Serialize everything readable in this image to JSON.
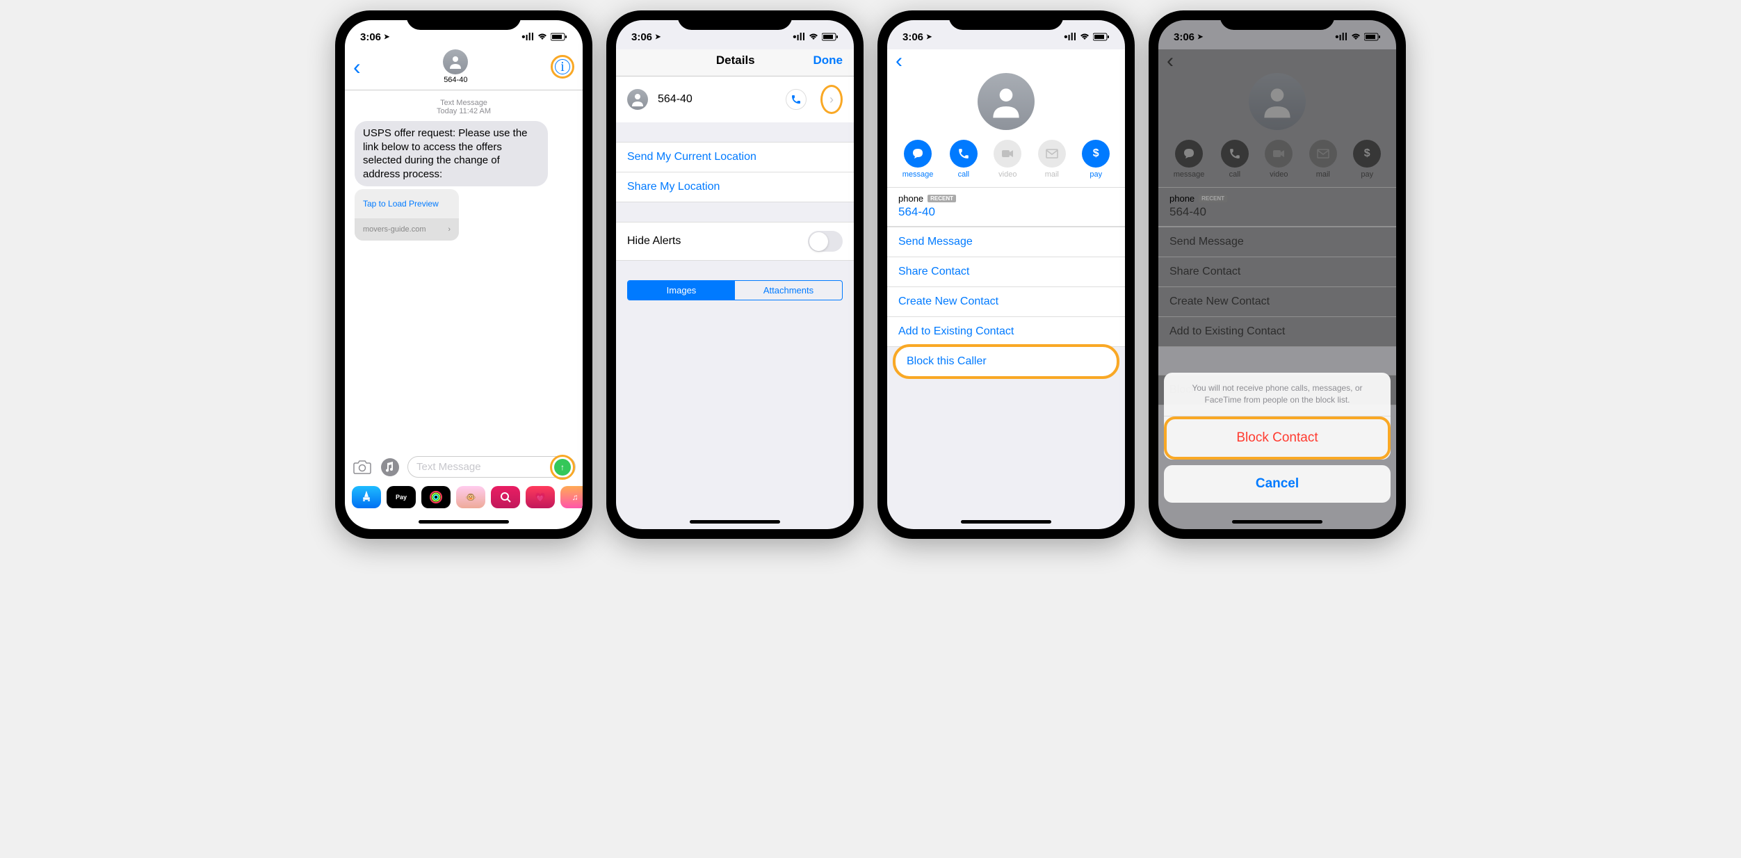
{
  "status": {
    "time": "3:06",
    "nav": "↗"
  },
  "s1": {
    "contact": "564-40",
    "meta_line1": "Text Message",
    "meta_line2": "Today 11:42 AM",
    "message": "USPS offer request: Please use the link below to access the offers selected during the change of address process:",
    "preview_tap": "Tap to Load Preview",
    "preview_domain": "movers-guide.com",
    "input_placeholder": "Text Message"
  },
  "s2": {
    "title": "Details",
    "done": "Done",
    "contact": "564-40",
    "send_location": "Send My Current Location",
    "share_location": "Share My Location",
    "hide_alerts": "Hide Alerts",
    "seg_images": "Images",
    "seg_attachments": "Attachments"
  },
  "s3": {
    "actions": {
      "message": "message",
      "call": "call",
      "video": "video",
      "mail": "mail",
      "pay": "pay"
    },
    "phone_label": "phone",
    "recent": "RECENT",
    "phone_value": "564-40",
    "send_message": "Send Message",
    "share_contact": "Share Contact",
    "create_contact": "Create New Contact",
    "add_existing": "Add to Existing Contact",
    "block_caller": "Block this Caller"
  },
  "s4": {
    "sheet_desc": "You will not receive phone calls, messages, or FaceTime from people on the block list.",
    "block": "Block Contact",
    "cancel": "Cancel"
  }
}
